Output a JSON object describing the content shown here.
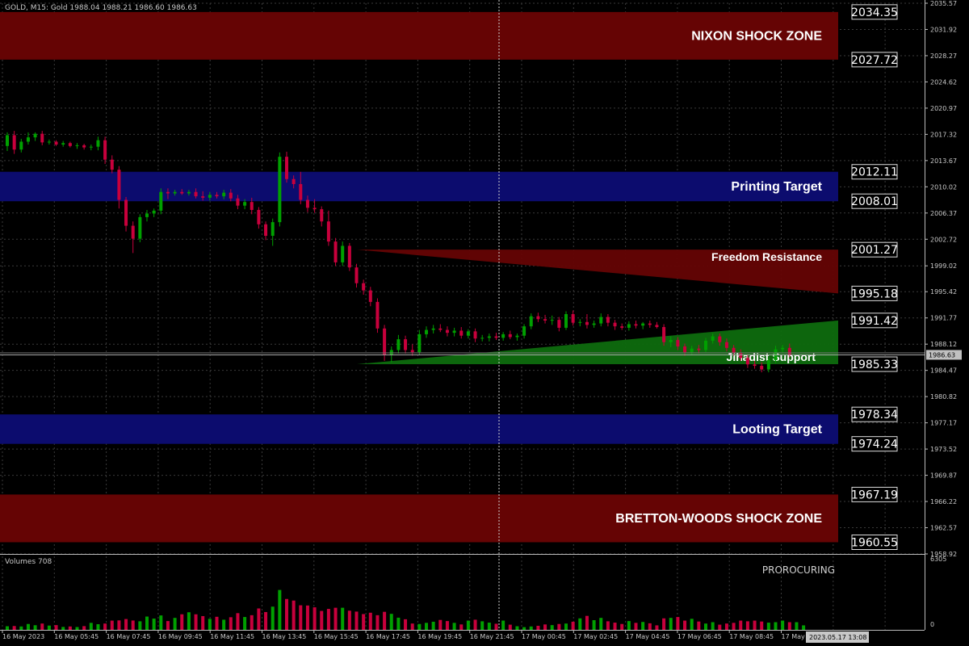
{
  "header": {
    "symbol_info": "GOLD, M15:  Gold  1988.04 1988.21 1986.60 1986.63"
  },
  "colors": {
    "background": "#000000",
    "grid": "#3a3a3a",
    "up_candle": "#00a000",
    "down_candle": "#c8003c",
    "red_zone": "#650404",
    "blue_zone": "#0c0c6e",
    "green_zone": "#0e6b0e",
    "axis_text": "#c8c8c8",
    "label_text": "#ffffff",
    "price_line": "#888888"
  },
  "zones": [
    {
      "id": "nixon",
      "label": "NIXON SHOCK ZONE",
      "top": 2034.35,
      "bottom": 2027.72,
      "color": "red"
    },
    {
      "id": "printing",
      "label": "Printing Target",
      "top": 2012.11,
      "bottom": 2008.01,
      "color": "blue"
    },
    {
      "id": "looting",
      "label": "Looting Target",
      "top": 1978.34,
      "bottom": 1974.24,
      "color": "blue"
    },
    {
      "id": "bretton",
      "label": "BRETTON-WOODS SHOCK ZONE",
      "top": 1967.19,
      "bottom": 1960.55,
      "color": "red"
    }
  ],
  "channels": [
    {
      "id": "freedom",
      "label": "Freedom Resistance",
      "left_price": 2001.27,
      "right_top": 2001.27,
      "right_bottom": 1995.18,
      "color": "red"
    },
    {
      "id": "jihadist",
      "label": "Jihadist Support",
      "left_price": 1985.33,
      "right_top": 1991.42,
      "right_bottom": 1985.33,
      "color": "green"
    }
  ],
  "level_labels": [
    "2034.35",
    "2027.72",
    "2012.11",
    "2008.01",
    "2001.27",
    "1995.18",
    "1991.42",
    "1985.33",
    "1978.34",
    "1974.24",
    "1967.19",
    "1960.55"
  ],
  "current_price_label": "1986.63",
  "y_ticks": [
    "2035.57",
    "2031.92",
    "2028.27",
    "2024.62",
    "2020.97",
    "2017.32",
    "2013.67",
    "2010.02",
    "2006.37",
    "2002.72",
    "1999.02",
    "1995.42",
    "1991.77",
    "1988.12",
    "1984.47",
    "1980.82",
    "1977.17",
    "1973.52",
    "1969.87",
    "1966.22",
    "1962.57",
    "1958.92"
  ],
  "x_ticks": [
    "16 May 2023",
    "16 May 05:45",
    "16 May 07:45",
    "16 May 09:45",
    "16 May 11:45",
    "16 May 13:45",
    "16 May 15:45",
    "16 May 17:45",
    "16 May 19:45",
    "16 May 21:45",
    "17 May 00:45",
    "17 May 02:45",
    "17 May 04:45",
    "17 May 06:45",
    "17 May 08:45",
    "17 May"
  ],
  "x_cursor_label": "2023.05.17 13:08",
  "volume_panel": {
    "title": "Volumes 708",
    "indicator": "PROROCURING",
    "max_label": "6305",
    "zero_label": "0"
  },
  "chart_data": {
    "type": "candlestick",
    "symbol": "GOLD",
    "timeframe": "M15",
    "ylim": [
      1958.92,
      2035.57
    ],
    "candles": [
      {
        "o": 2015.7,
        "h": 2017.6,
        "l": 2015.0,
        "c": 2017.2
      },
      {
        "o": 2017.2,
        "h": 2017.8,
        "l": 2014.6,
        "c": 2015.2
      },
      {
        "o": 2015.2,
        "h": 2016.7,
        "l": 2014.8,
        "c": 2016.3
      },
      {
        "o": 2016.3,
        "h": 2017.6,
        "l": 2015.9,
        "c": 2016.9
      },
      {
        "o": 2016.9,
        "h": 2017.6,
        "l": 2016.4,
        "c": 2017.4
      },
      {
        "o": 2017.4,
        "h": 2017.8,
        "l": 2015.8,
        "c": 2016.2
      },
      {
        "o": 2016.2,
        "h": 2016.6,
        "l": 2015.9,
        "c": 2016.3
      },
      {
        "o": 2016.3,
        "h": 2016.5,
        "l": 2015.7,
        "c": 2015.9
      },
      {
        "o": 2015.9,
        "h": 2016.4,
        "l": 2015.6,
        "c": 2016.1
      },
      {
        "o": 2016.1,
        "h": 2016.3,
        "l": 2015.5,
        "c": 2015.7
      },
      {
        "o": 2015.7,
        "h": 2016.1,
        "l": 2015.3,
        "c": 2015.8
      },
      {
        "o": 2015.8,
        "h": 2016.0,
        "l": 2015.2,
        "c": 2015.5
      },
      {
        "o": 2015.5,
        "h": 2015.9,
        "l": 2015.1,
        "c": 2015.6
      },
      {
        "o": 2015.6,
        "h": 2017.0,
        "l": 2015.1,
        "c": 2016.5
      },
      {
        "o": 2016.5,
        "h": 2017.0,
        "l": 2013.2,
        "c": 2013.8
      },
      {
        "o": 2013.8,
        "h": 2014.4,
        "l": 2011.9,
        "c": 2012.4
      },
      {
        "o": 2012.4,
        "h": 2012.9,
        "l": 2007.0,
        "c": 2008.2
      },
      {
        "o": 2008.2,
        "h": 2008.6,
        "l": 2003.8,
        "c": 2004.6
      },
      {
        "o": 2004.6,
        "h": 2005.2,
        "l": 2000.8,
        "c": 2002.8
      },
      {
        "o": 2002.8,
        "h": 2006.2,
        "l": 2002.3,
        "c": 2005.8
      },
      {
        "o": 2005.8,
        "h": 2006.8,
        "l": 2005.2,
        "c": 2006.3
      },
      {
        "o": 2006.3,
        "h": 2007.0,
        "l": 2005.8,
        "c": 2006.7
      },
      {
        "o": 2006.7,
        "h": 2009.8,
        "l": 2006.2,
        "c": 2009.3
      },
      {
        "o": 2009.3,
        "h": 2009.8,
        "l": 2008.3,
        "c": 2009.1
      },
      {
        "o": 2009.1,
        "h": 2009.6,
        "l": 2008.8,
        "c": 2009.3
      },
      {
        "o": 2009.3,
        "h": 2009.7,
        "l": 2008.9,
        "c": 2009.1
      },
      {
        "o": 2009.1,
        "h": 2009.6,
        "l": 2008.8,
        "c": 2009.3
      },
      {
        "o": 2009.3,
        "h": 2009.8,
        "l": 2008.4,
        "c": 2008.7
      },
      {
        "o": 2008.7,
        "h": 2009.4,
        "l": 2008.1,
        "c": 2008.5
      },
      {
        "o": 2008.5,
        "h": 2009.3,
        "l": 2008.1,
        "c": 2008.9
      },
      {
        "o": 2008.9,
        "h": 2009.3,
        "l": 2008.4,
        "c": 2008.7
      },
      {
        "o": 2008.7,
        "h": 2009.6,
        "l": 2008.3,
        "c": 2009.2
      },
      {
        "o": 2009.2,
        "h": 2009.7,
        "l": 2008.0,
        "c": 2008.4
      },
      {
        "o": 2008.4,
        "h": 2008.9,
        "l": 2006.9,
        "c": 2007.4
      },
      {
        "o": 2007.4,
        "h": 2008.3,
        "l": 2006.9,
        "c": 2007.9
      },
      {
        "o": 2007.9,
        "h": 2008.5,
        "l": 2006.2,
        "c": 2006.8
      },
      {
        "o": 2006.8,
        "h": 2007.2,
        "l": 2004.2,
        "c": 2004.8
      },
      {
        "o": 2004.8,
        "h": 2005.2,
        "l": 2002.6,
        "c": 2003.2
      },
      {
        "o": 2003.2,
        "h": 2005.6,
        "l": 2001.8,
        "c": 2005.1
      },
      {
        "o": 2005.1,
        "h": 2014.8,
        "l": 2004.5,
        "c": 2014.2
      },
      {
        "o": 2014.2,
        "h": 2014.9,
        "l": 2010.6,
        "c": 2011.1
      },
      {
        "o": 2011.1,
        "h": 2011.6,
        "l": 2009.8,
        "c": 2010.4
      },
      {
        "o": 2010.4,
        "h": 2012.1,
        "l": 2007.6,
        "c": 2008.2
      },
      {
        "o": 2008.2,
        "h": 2008.8,
        "l": 2006.5,
        "c": 2007.1
      },
      {
        "o": 2007.1,
        "h": 2008.3,
        "l": 2006.4,
        "c": 2006.9
      },
      {
        "o": 2006.9,
        "h": 2007.3,
        "l": 2004.5,
        "c": 2005.2
      },
      {
        "o": 2005.2,
        "h": 2006.7,
        "l": 2001.8,
        "c": 2002.4
      },
      {
        "o": 2002.4,
        "h": 2002.9,
        "l": 1999.0,
        "c": 1999.5
      },
      {
        "o": 1999.5,
        "h": 2002.4,
        "l": 1999.0,
        "c": 2001.8
      },
      {
        "o": 2001.8,
        "h": 2002.2,
        "l": 1998.3,
        "c": 1998.8
      },
      {
        "o": 1998.8,
        "h": 1999.3,
        "l": 1996.0,
        "c": 1996.6
      },
      {
        "o": 1996.6,
        "h": 1997.1,
        "l": 1995.0,
        "c": 1995.6
      },
      {
        "o": 1995.6,
        "h": 1996.1,
        "l": 1993.4,
        "c": 1994.0
      },
      {
        "o": 1994.0,
        "h": 1994.5,
        "l": 1989.7,
        "c": 1990.3
      },
      {
        "o": 1990.3,
        "h": 1990.8,
        "l": 1985.8,
        "c": 1986.6
      },
      {
        "o": 1986.6,
        "h": 1987.8,
        "l": 1985.6,
        "c": 1987.3
      },
      {
        "o": 1987.3,
        "h": 1989.4,
        "l": 1986.8,
        "c": 1988.8
      },
      {
        "o": 1988.8,
        "h": 1989.3,
        "l": 1986.8,
        "c": 1987.3
      },
      {
        "o": 1987.3,
        "h": 1988.1,
        "l": 1986.5,
        "c": 1987.0
      },
      {
        "o": 1987.0,
        "h": 1990.1,
        "l": 1986.6,
        "c": 1989.5
      },
      {
        "o": 1989.5,
        "h": 1990.6,
        "l": 1989.0,
        "c": 1990.1
      },
      {
        "o": 1990.1,
        "h": 1990.8,
        "l": 1989.6,
        "c": 1990.3
      },
      {
        "o": 1990.3,
        "h": 1990.9,
        "l": 1989.8,
        "c": 1990.1
      },
      {
        "o": 1990.1,
        "h": 1990.6,
        "l": 1989.2,
        "c": 1989.7
      },
      {
        "o": 1989.7,
        "h": 1990.4,
        "l": 1989.2,
        "c": 1990.0
      },
      {
        "o": 1990.0,
        "h": 1990.5,
        "l": 1988.9,
        "c": 1989.3
      },
      {
        "o": 1989.3,
        "h": 1990.2,
        "l": 1988.9,
        "c": 1989.9
      },
      {
        "o": 1989.9,
        "h": 1990.3,
        "l": 1988.4,
        "c": 1988.9
      },
      {
        "o": 1988.9,
        "h": 1989.4,
        "l": 1988.5,
        "c": 1989.0
      },
      {
        "o": 1989.0,
        "h": 1989.6,
        "l": 1988.5,
        "c": 1989.2
      },
      {
        "o": 1989.2,
        "h": 1989.7,
        "l": 1988.7,
        "c": 1989.0
      },
      {
        "o": 1989.0,
        "h": 1989.8,
        "l": 1988.6,
        "c": 1989.5
      },
      {
        "o": 1989.5,
        "h": 1990.0,
        "l": 1988.8,
        "c": 1989.1
      },
      {
        "o": 1989.1,
        "h": 1989.6,
        "l": 1988.6,
        "c": 1989.3
      },
      {
        "o": 1989.3,
        "h": 1990.9,
        "l": 1988.9,
        "c": 1990.6
      },
      {
        "o": 1990.6,
        "h": 1992.4,
        "l": 1990.2,
        "c": 1992.0
      },
      {
        "o": 1992.0,
        "h": 1992.5,
        "l": 1991.2,
        "c": 1991.6
      },
      {
        "o": 1991.6,
        "h": 1992.2,
        "l": 1991.0,
        "c": 1991.4
      },
      {
        "o": 1991.4,
        "h": 1992.1,
        "l": 1990.8,
        "c": 1991.5
      },
      {
        "o": 1991.5,
        "h": 1991.9,
        "l": 1989.9,
        "c": 1990.4
      },
      {
        "o": 1990.4,
        "h": 1992.7,
        "l": 1990.1,
        "c": 1992.3
      },
      {
        "o": 1992.3,
        "h": 1992.8,
        "l": 1990.7,
        "c": 1991.1
      },
      {
        "o": 1991.1,
        "h": 1991.6,
        "l": 1990.6,
        "c": 1991.2
      },
      {
        "o": 1991.2,
        "h": 1992.3,
        "l": 1990.3,
        "c": 1990.8
      },
      {
        "o": 1990.8,
        "h": 1991.4,
        "l": 1990.4,
        "c": 1991.0
      },
      {
        "o": 1991.0,
        "h": 1992.4,
        "l": 1990.6,
        "c": 1991.9
      },
      {
        "o": 1991.9,
        "h": 1992.3,
        "l": 1990.6,
        "c": 1991.1
      },
      {
        "o": 1991.1,
        "h": 1991.5,
        "l": 1990.1,
        "c": 1990.6
      },
      {
        "o": 1990.6,
        "h": 1991.0,
        "l": 1990.1,
        "c": 1990.4
      },
      {
        "o": 1990.4,
        "h": 1991.3,
        "l": 1990.0,
        "c": 1990.9
      },
      {
        "o": 1990.9,
        "h": 1991.4,
        "l": 1990.3,
        "c": 1990.7
      },
      {
        "o": 1990.7,
        "h": 1991.2,
        "l": 1990.2,
        "c": 1991.0
      },
      {
        "o": 1991.0,
        "h": 1991.4,
        "l": 1990.4,
        "c": 1990.8
      },
      {
        "o": 1990.8,
        "h": 1991.2,
        "l": 1990.3,
        "c": 1990.5
      },
      {
        "o": 1990.5,
        "h": 1990.9,
        "l": 1987.9,
        "c": 1988.4
      },
      {
        "o": 1988.4,
        "h": 1989.2,
        "l": 1987.7,
        "c": 1988.7
      },
      {
        "o": 1988.7,
        "h": 1989.1,
        "l": 1987.3,
        "c": 1987.8
      },
      {
        "o": 1987.8,
        "h": 1988.2,
        "l": 1986.5,
        "c": 1987.0
      },
      {
        "o": 1987.0,
        "h": 1987.9,
        "l": 1986.6,
        "c": 1987.5
      },
      {
        "o": 1987.5,
        "h": 1988.0,
        "l": 1986.8,
        "c": 1987.3
      },
      {
        "o": 1987.3,
        "h": 1989.0,
        "l": 1987.0,
        "c": 1988.6
      },
      {
        "o": 1988.6,
        "h": 1989.6,
        "l": 1988.2,
        "c": 1989.2
      },
      {
        "o": 1989.2,
        "h": 1989.6,
        "l": 1987.9,
        "c": 1988.4
      },
      {
        "o": 1988.4,
        "h": 1988.9,
        "l": 1987.1,
        "c": 1987.6
      },
      {
        "o": 1987.6,
        "h": 1988.0,
        "l": 1986.5,
        "c": 1986.9
      },
      {
        "o": 1986.9,
        "h": 1987.4,
        "l": 1985.8,
        "c": 1986.2
      },
      {
        "o": 1986.2,
        "h": 1986.7,
        "l": 1984.8,
        "c": 1985.3
      },
      {
        "o": 1985.3,
        "h": 1985.8,
        "l": 1984.7,
        "c": 1985.1
      },
      {
        "o": 1985.1,
        "h": 1985.6,
        "l": 1984.2,
        "c": 1984.6
      },
      {
        "o": 1984.6,
        "h": 1986.3,
        "l": 1984.2,
        "c": 1985.9
      },
      {
        "o": 1985.9,
        "h": 1987.9,
        "l": 1985.5,
        "c": 1987.4
      },
      {
        "o": 1987.4,
        "h": 1988.0,
        "l": 1986.9,
        "c": 1987.6
      },
      {
        "o": 1987.6,
        "h": 1988.2,
        "l": 1986.3,
        "c": 1986.6
      }
    ],
    "volumes": [
      320,
      340,
      300,
      520,
      410,
      560,
      380,
      420,
      260,
      300,
      250,
      330,
      620,
      500,
      560,
      820,
      840,
      960,
      830,
      760,
      1180,
      1000,
      1280,
      780,
      1060,
      1380,
      1560,
      1380,
      1220,
      980,
      1160,
      900,
      1120,
      1480,
      1140,
      1300,
      1900,
      1580,
      2060,
      3540,
      2740,
      2600,
      2180,
      2160,
      2000,
      1680,
      1860,
      1960,
      1960,
      1700,
      1620,
      1400,
      1520,
      1300,
      1600,
      1420,
      1080,
      940,
      560,
      520,
      620,
      720,
      880,
      780,
      620,
      480,
      820,
      900,
      760,
      640,
      540,
      820,
      460,
      320,
      240,
      300,
      360,
      480,
      420,
      520,
      560,
      720,
      1020,
      1240,
      860,
      1060,
      760,
      640,
      520,
      780,
      620,
      700,
      580,
      400,
      1020,
      1060,
      1140,
      820,
      980,
      740,
      560,
      680,
      460,
      560,
      620,
      820,
      760,
      820,
      740,
      640,
      680,
      820,
      680,
      680,
      400
    ]
  }
}
